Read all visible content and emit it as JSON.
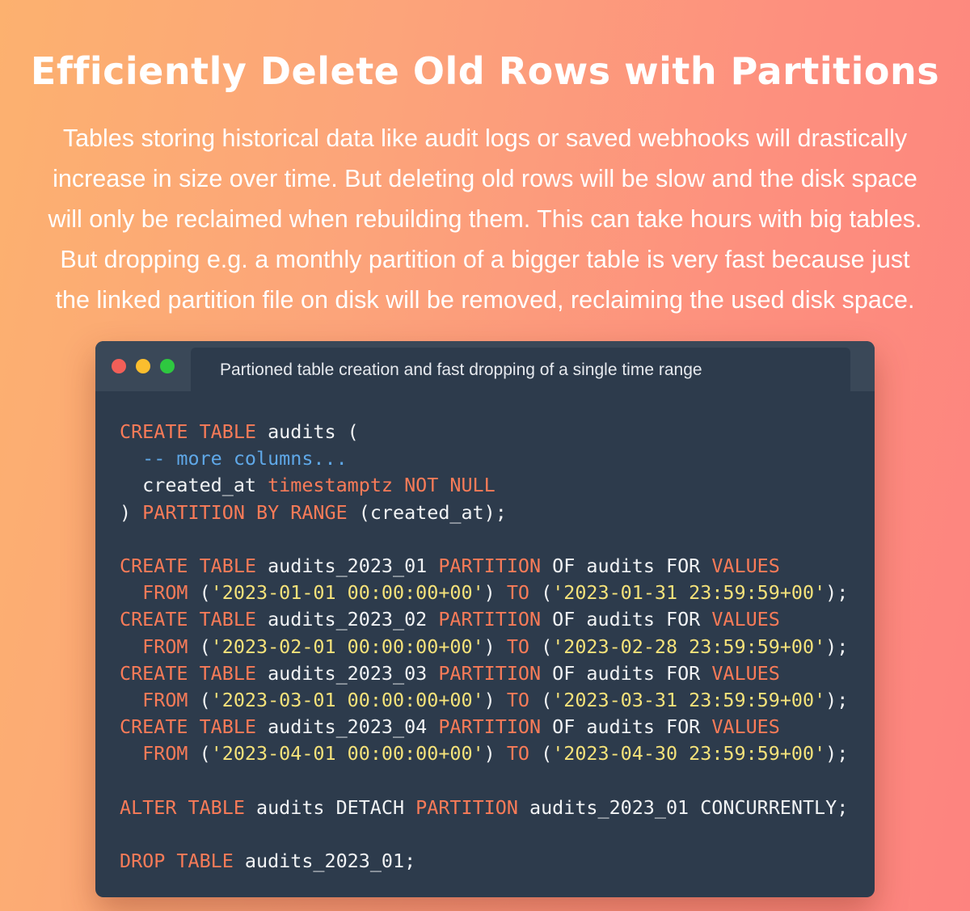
{
  "title": "Efficiently Delete Old Rows with Partitions",
  "intro_lines": [
    "Tables storing historical data like audit logs or saved webhooks will drastically",
    "increase in size over time. But deleting old rows will be slow and the disk space",
    "will only be reclaimed when rebuilding them. This can take hours with big tables.",
    "But dropping e.g. a monthly partition of a bigger table is very fast because just",
    "the linked partition file on disk will be removed, reclaiming the used disk space."
  ],
  "window": {
    "tab_label": "Partioned table creation and fast dropping of a single time range"
  },
  "colors": {
    "keyword": "#f97b58",
    "string": "#f5e27a",
    "comment": "#5fa8e8",
    "text": "#f1f3f5",
    "editor_bg": "#2d3b4c"
  },
  "code_lines": [
    [
      {
        "t": "kw",
        "v": "CREATE TABLE"
      },
      {
        "t": "plain",
        "v": " audits ("
      }
    ],
    [
      {
        "t": "plain",
        "v": "  "
      },
      {
        "t": "comment",
        "v": "-- more columns..."
      }
    ],
    [
      {
        "t": "plain",
        "v": "  created_at "
      },
      {
        "t": "kw",
        "v": "timestamptz NOT NULL"
      }
    ],
    [
      {
        "t": "plain",
        "v": ") "
      },
      {
        "t": "kw",
        "v": "PARTITION BY RANGE"
      },
      {
        "t": "plain",
        "v": " (created_at);"
      }
    ],
    [],
    [
      {
        "t": "kw",
        "v": "CREATE TABLE"
      },
      {
        "t": "plain",
        "v": " audits_2023_01 "
      },
      {
        "t": "kw",
        "v": "PARTITION"
      },
      {
        "t": "plain",
        "v": " OF audits FOR "
      },
      {
        "t": "kw",
        "v": "VALUES"
      }
    ],
    [
      {
        "t": "plain",
        "v": "  "
      },
      {
        "t": "kw",
        "v": "FROM"
      },
      {
        "t": "plain",
        "v": " ("
      },
      {
        "t": "str",
        "v": "'2023-01-01 00:00:00+00'"
      },
      {
        "t": "plain",
        "v": ") "
      },
      {
        "t": "kw",
        "v": "TO"
      },
      {
        "t": "plain",
        "v": " ("
      },
      {
        "t": "str",
        "v": "'2023-01-31 23:59:59+00'"
      },
      {
        "t": "plain",
        "v": ");"
      }
    ],
    [
      {
        "t": "kw",
        "v": "CREATE TABLE"
      },
      {
        "t": "plain",
        "v": " audits_2023_02 "
      },
      {
        "t": "kw",
        "v": "PARTITION"
      },
      {
        "t": "plain",
        "v": " OF audits FOR "
      },
      {
        "t": "kw",
        "v": "VALUES"
      }
    ],
    [
      {
        "t": "plain",
        "v": "  "
      },
      {
        "t": "kw",
        "v": "FROM"
      },
      {
        "t": "plain",
        "v": " ("
      },
      {
        "t": "str",
        "v": "'2023-02-01 00:00:00+00'"
      },
      {
        "t": "plain",
        "v": ") "
      },
      {
        "t": "kw",
        "v": "TO"
      },
      {
        "t": "plain",
        "v": " ("
      },
      {
        "t": "str",
        "v": "'2023-02-28 23:59:59+00'"
      },
      {
        "t": "plain",
        "v": ");"
      }
    ],
    [
      {
        "t": "kw",
        "v": "CREATE TABLE"
      },
      {
        "t": "plain",
        "v": " audits_2023_03 "
      },
      {
        "t": "kw",
        "v": "PARTITION"
      },
      {
        "t": "plain",
        "v": " OF audits FOR "
      },
      {
        "t": "kw",
        "v": "VALUES"
      }
    ],
    [
      {
        "t": "plain",
        "v": "  "
      },
      {
        "t": "kw",
        "v": "FROM"
      },
      {
        "t": "plain",
        "v": " ("
      },
      {
        "t": "str",
        "v": "'2023-03-01 00:00:00+00'"
      },
      {
        "t": "plain",
        "v": ") "
      },
      {
        "t": "kw",
        "v": "TO"
      },
      {
        "t": "plain",
        "v": " ("
      },
      {
        "t": "str",
        "v": "'2023-03-31 23:59:59+00'"
      },
      {
        "t": "plain",
        "v": ");"
      }
    ],
    [
      {
        "t": "kw",
        "v": "CREATE TABLE"
      },
      {
        "t": "plain",
        "v": " audits_2023_04 "
      },
      {
        "t": "kw",
        "v": "PARTITION"
      },
      {
        "t": "plain",
        "v": " OF audits FOR "
      },
      {
        "t": "kw",
        "v": "VALUES"
      }
    ],
    [
      {
        "t": "plain",
        "v": "  "
      },
      {
        "t": "kw",
        "v": "FROM"
      },
      {
        "t": "plain",
        "v": " ("
      },
      {
        "t": "str",
        "v": "'2023-04-01 00:00:00+00'"
      },
      {
        "t": "plain",
        "v": ") "
      },
      {
        "t": "kw",
        "v": "TO"
      },
      {
        "t": "plain",
        "v": " ("
      },
      {
        "t": "str",
        "v": "'2023-04-30 23:59:59+00'"
      },
      {
        "t": "plain",
        "v": ");"
      }
    ],
    [],
    [
      {
        "t": "kw",
        "v": "ALTER TABLE"
      },
      {
        "t": "plain",
        "v": " audits DETACH "
      },
      {
        "t": "kw",
        "v": "PARTITION"
      },
      {
        "t": "plain",
        "v": " audits_2023_01 CONCURRENTLY;"
      }
    ],
    [],
    [
      {
        "t": "kw",
        "v": "DROP TABLE"
      },
      {
        "t": "plain",
        "v": " audits_2023_01;"
      }
    ]
  ]
}
